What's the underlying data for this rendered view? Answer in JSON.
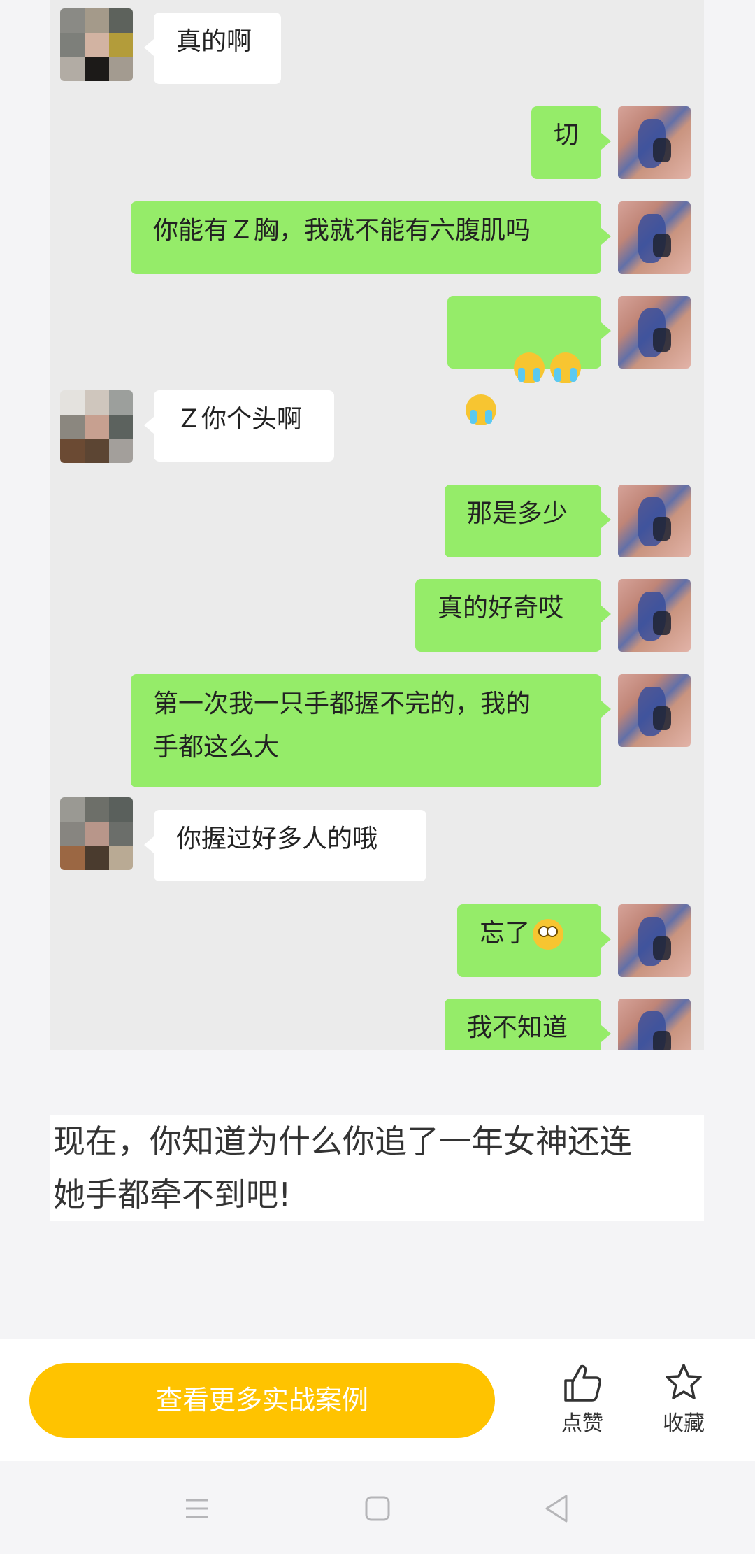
{
  "chat": {
    "messages": [
      {
        "side": "in",
        "text": "真的啊"
      },
      {
        "side": "out",
        "text": "切"
      },
      {
        "side": "out",
        "text": "你能有Ｚ胸，我就不能有六腹肌吗"
      },
      {
        "side": "out",
        "emoji": [
          "crying-face",
          "crying-face",
          "crying-face"
        ]
      },
      {
        "side": "in",
        "text": "Ｚ你个头啊"
      },
      {
        "side": "out",
        "text": "那是多少"
      },
      {
        "side": "out",
        "text": "真的好奇哎"
      },
      {
        "side": "out",
        "text": "第一次我一只手都握不完的，我的\n手都这么大"
      },
      {
        "side": "in",
        "text": "你握过好多人的哦"
      },
      {
        "side": "out",
        "text": "忘了",
        "emoji": [
          "eye-roll-face"
        ]
      },
      {
        "side": "out",
        "text": "我不知道"
      }
    ]
  },
  "caption": {
    "line1": "现在，你知道为什么你追了一年女神还连",
    "line2": "她手都牵不到吧!"
  },
  "bottom_bar": {
    "cta_label": "查看更多实战案例",
    "like_label": "点赞",
    "favorite_label": "收藏",
    "cta_color": "#ffc300"
  },
  "colors": {
    "outgoing_bubble": "#95ec69",
    "incoming_bubble": "#ffffff",
    "chat_background": "#ebebeb"
  },
  "icons": {
    "like": "thumbs-up-icon",
    "favorite": "star-icon",
    "nav_menu": "menu-icon",
    "nav_home": "home-square-icon",
    "nav_back": "back-triangle-icon"
  }
}
